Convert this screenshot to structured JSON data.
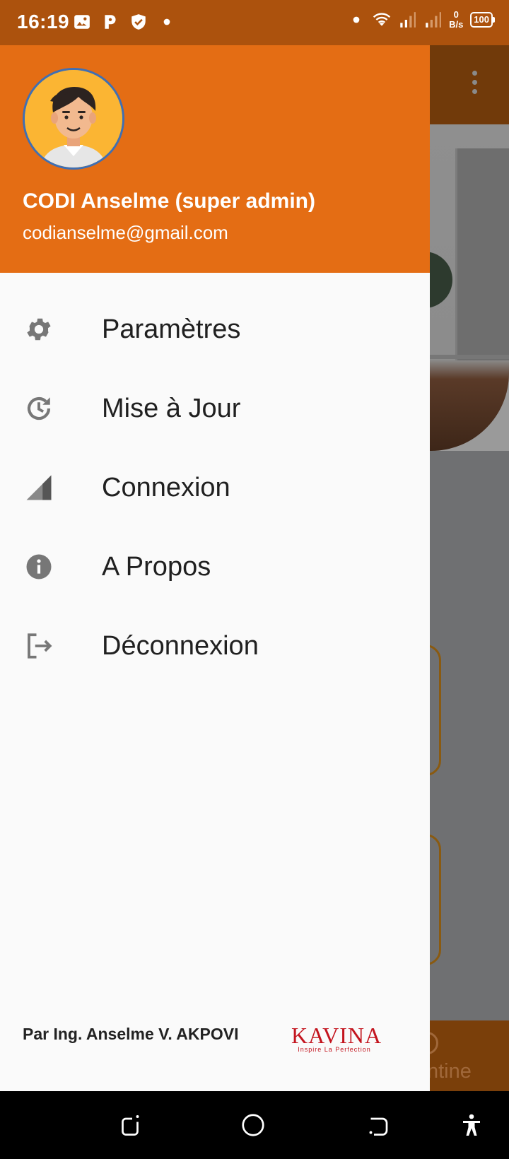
{
  "status_bar": {
    "time": "16:19",
    "net_speed_value": "0",
    "net_speed_unit": "B/s",
    "battery": "100",
    "icons_left": [
      "image-icon",
      "p-app-icon",
      "shield-check-icon",
      "dot-icon"
    ],
    "icons_right": [
      "dot-icon",
      "wifi-icon",
      "signal-icon",
      "signal-icon",
      "battery-icon"
    ]
  },
  "drawer": {
    "user": {
      "name": "CODI Anselme (super admin)",
      "email": "codianselme@gmail.com",
      "avatar": "avatar-cartoon-man"
    },
    "menu": [
      {
        "label": "Paramètres",
        "icon": "gear-icon"
      },
      {
        "label": "Mise à Jour",
        "icon": "update-clock-icon"
      },
      {
        "label": "Connexion",
        "icon": "signal-icon"
      },
      {
        "label": "A Propos",
        "icon": "info-icon"
      },
      {
        "label": "Déconnexion",
        "icon": "logout-icon"
      }
    ],
    "footer": {
      "credit": "Par Ing. Anselme V. AKPOVI",
      "logo_word": "KAVINA",
      "logo_tagline": "Inspire La Perfection"
    }
  },
  "background": {
    "bottom_tab_label": "ntine"
  },
  "colors": {
    "header": "#e46d14",
    "status_bar": "#ac520d",
    "drawer_bg": "#fafafa",
    "icon_grey": "#777777",
    "logo_red": "#c3141e"
  }
}
